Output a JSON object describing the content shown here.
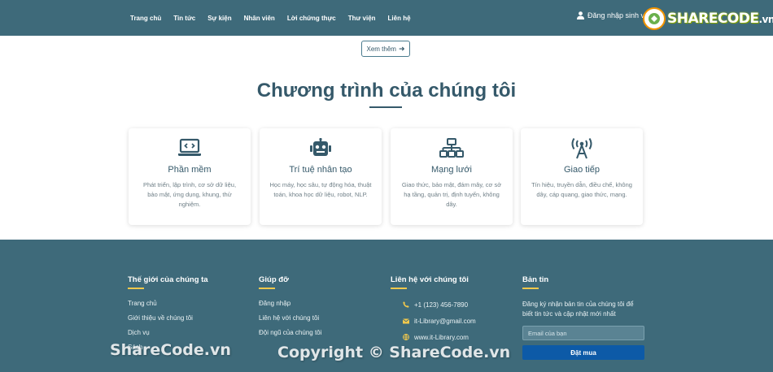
{
  "nav": {
    "links": [
      "Trang chủ",
      "Tin tức",
      "Sự kiện",
      "Nhân viên",
      "Lời chứng thực",
      "Thư viện",
      "Liên hệ"
    ],
    "login_label": "Đăng nhập sinh vi"
  },
  "logo": {
    "word": "SHARECODE",
    "tld": ".vn"
  },
  "more_button": {
    "label": "Xem thêm",
    "arrow": "➜"
  },
  "programs": {
    "title": "Chương trình của chúng tôi",
    "cards": [
      {
        "title": "Phần mềm",
        "desc": "Phát triển, lập trình, cơ sở dữ liệu, bảo mật, ứng dụng, khung, thử nghiệm.",
        "icon": "laptop-code-icon"
      },
      {
        "title": "Trí tuệ nhân tạo",
        "desc": "Học máy, học sâu, tự động hóa, thuật toán, khoa học dữ liệu, robot, NLP.",
        "icon": "robot-icon"
      },
      {
        "title": "Mạng lưới",
        "desc": "Giao thức, bảo mật, đám mây, cơ sở hạ tầng, quản trị, định tuyến, không dây.",
        "icon": "network-icon"
      },
      {
        "title": "Giao tiếp",
        "desc": "Tín hiệu, truyền dẫn, điều chế, không dây, cáp quang, giao thức, mạng.",
        "icon": "broadcast-tower-icon"
      }
    ]
  },
  "footer": {
    "col1": {
      "heading": "Thế giới của chúng ta",
      "items": [
        "Trang chủ",
        "Giới thiệu về chúng tôi",
        "Dịch vụ",
        "Sách"
      ]
    },
    "col2": {
      "heading": "Giúp đỡ",
      "items": [
        "Đăng nhập",
        "Liên hệ với chúng tôi",
        "Đội ngũ của chúng tôi"
      ]
    },
    "col3": {
      "heading": "Liên hệ với chúng tôi",
      "phone": "+1 (123) 456-7890",
      "email": "it-Library@gmail.com",
      "website": "www.it-Library.com"
    },
    "col4": {
      "heading": "Bản tin",
      "desc": "Đăng ký nhận bản tin của chúng tôi để biết tin tức và cập nhật mới nhất",
      "email_placeholder": "Email của bạn",
      "button": "Đặt mua"
    }
  },
  "watermarks": {
    "left": "ShareCode.vn",
    "center": "Copyright © ShareCode.vn"
  },
  "colors": {
    "primary": "#3e6a7a",
    "heading": "#35596a",
    "accent_line": "#f2c94c",
    "button_blue": "#0d5aa7"
  }
}
